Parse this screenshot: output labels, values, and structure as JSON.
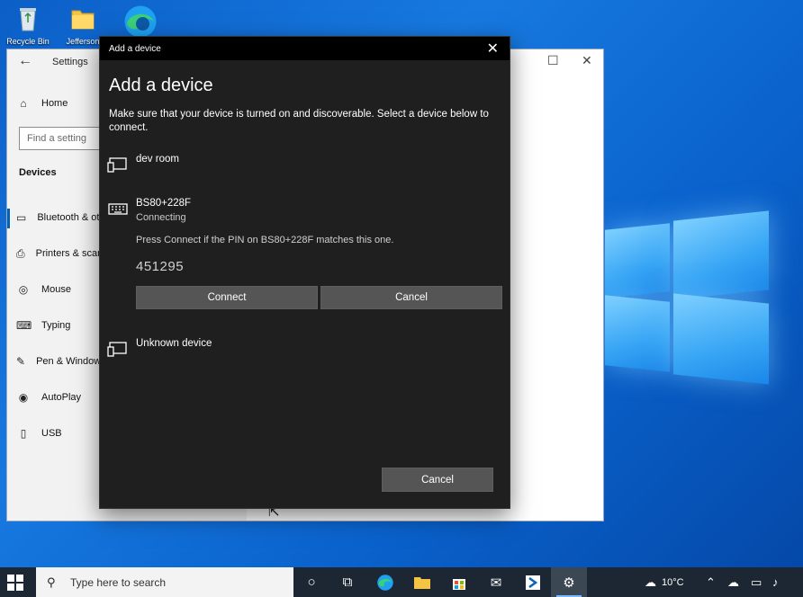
{
  "desktop": {
    "icons": [
      {
        "name": "recycle-bin",
        "label": "Recycle Bin"
      },
      {
        "name": "folder",
        "label": "Jefferson"
      },
      {
        "name": "edge",
        "label": ""
      }
    ]
  },
  "settings": {
    "title": "Settings",
    "home_label": "Home",
    "search_placeholder": "Find a setting",
    "section_label": "Devices",
    "items": [
      {
        "label": "Bluetooth & other devices"
      },
      {
        "label": "Printers & scanners"
      },
      {
        "label": "Mouse"
      },
      {
        "label": "Typing"
      },
      {
        "label": "Pen & Windows Ink"
      },
      {
        "label": "AutoPlay"
      },
      {
        "label": "USB"
      }
    ]
  },
  "dialog": {
    "titlebar": "Add a device",
    "heading": "Add a device",
    "description": "Make sure that your device is turned on and discoverable. Select a device below to connect.",
    "devices": [
      {
        "name": "dev room",
        "icon": "display-device-icon"
      },
      {
        "name": "BS80+228F",
        "status": "Connecting",
        "icon": "keyboard-icon"
      },
      {
        "name": "Unknown device",
        "icon": "display-device-icon"
      }
    ],
    "pin_message": "Press Connect if the PIN on BS80+228F matches this one.",
    "pin": "451295",
    "connect_label": "Connect",
    "cancel_label": "Cancel",
    "footer_cancel_label": "Cancel"
  },
  "taskbar": {
    "search_placeholder": "Type here to search",
    "temperature": "10°C"
  }
}
